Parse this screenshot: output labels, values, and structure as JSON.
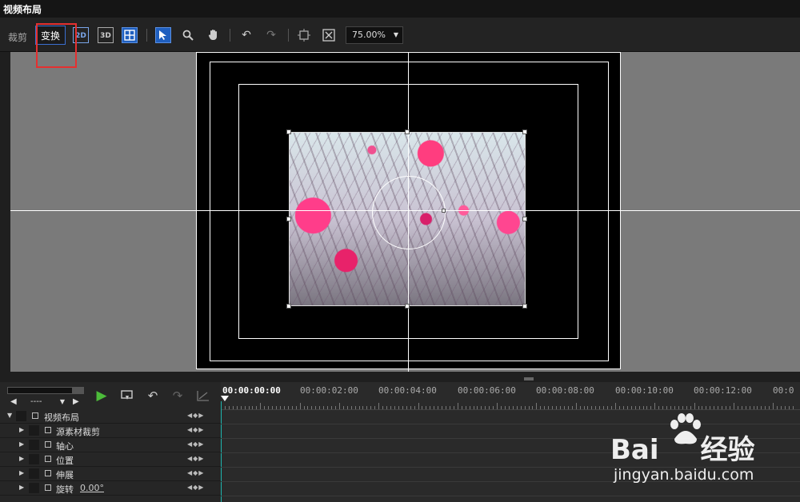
{
  "window": {
    "title": "视频布局"
  },
  "toolbar": {
    "crop_label": "裁剪",
    "transform_label": "变换",
    "zoom_value": "75.00%"
  },
  "timeline": {
    "select_value": "----",
    "current_time": "00:00:00:00",
    "ruler_times": [
      "00:00:02:00",
      "00:00:04:00",
      "00:00:06:00",
      "00:00:08:00",
      "00:00:10:00",
      "00:00:12:00",
      "00:0"
    ]
  },
  "tracks": [
    {
      "label": "视频布局"
    },
    {
      "label": "源素材裁剪"
    },
    {
      "label": "轴心"
    },
    {
      "label": "位置"
    },
    {
      "label": "伸展"
    },
    {
      "label": "旋转",
      "value": "0.00°"
    }
  ],
  "watermark": {
    "brand_left": "Bai",
    "brand_right": "经验",
    "url": "jingyan.baidu.com"
  },
  "colors": {
    "accent": "#1f5fbf",
    "play": "#4cbb3a",
    "highlight": "#e53030",
    "playhead": "#1fb7b0"
  }
}
